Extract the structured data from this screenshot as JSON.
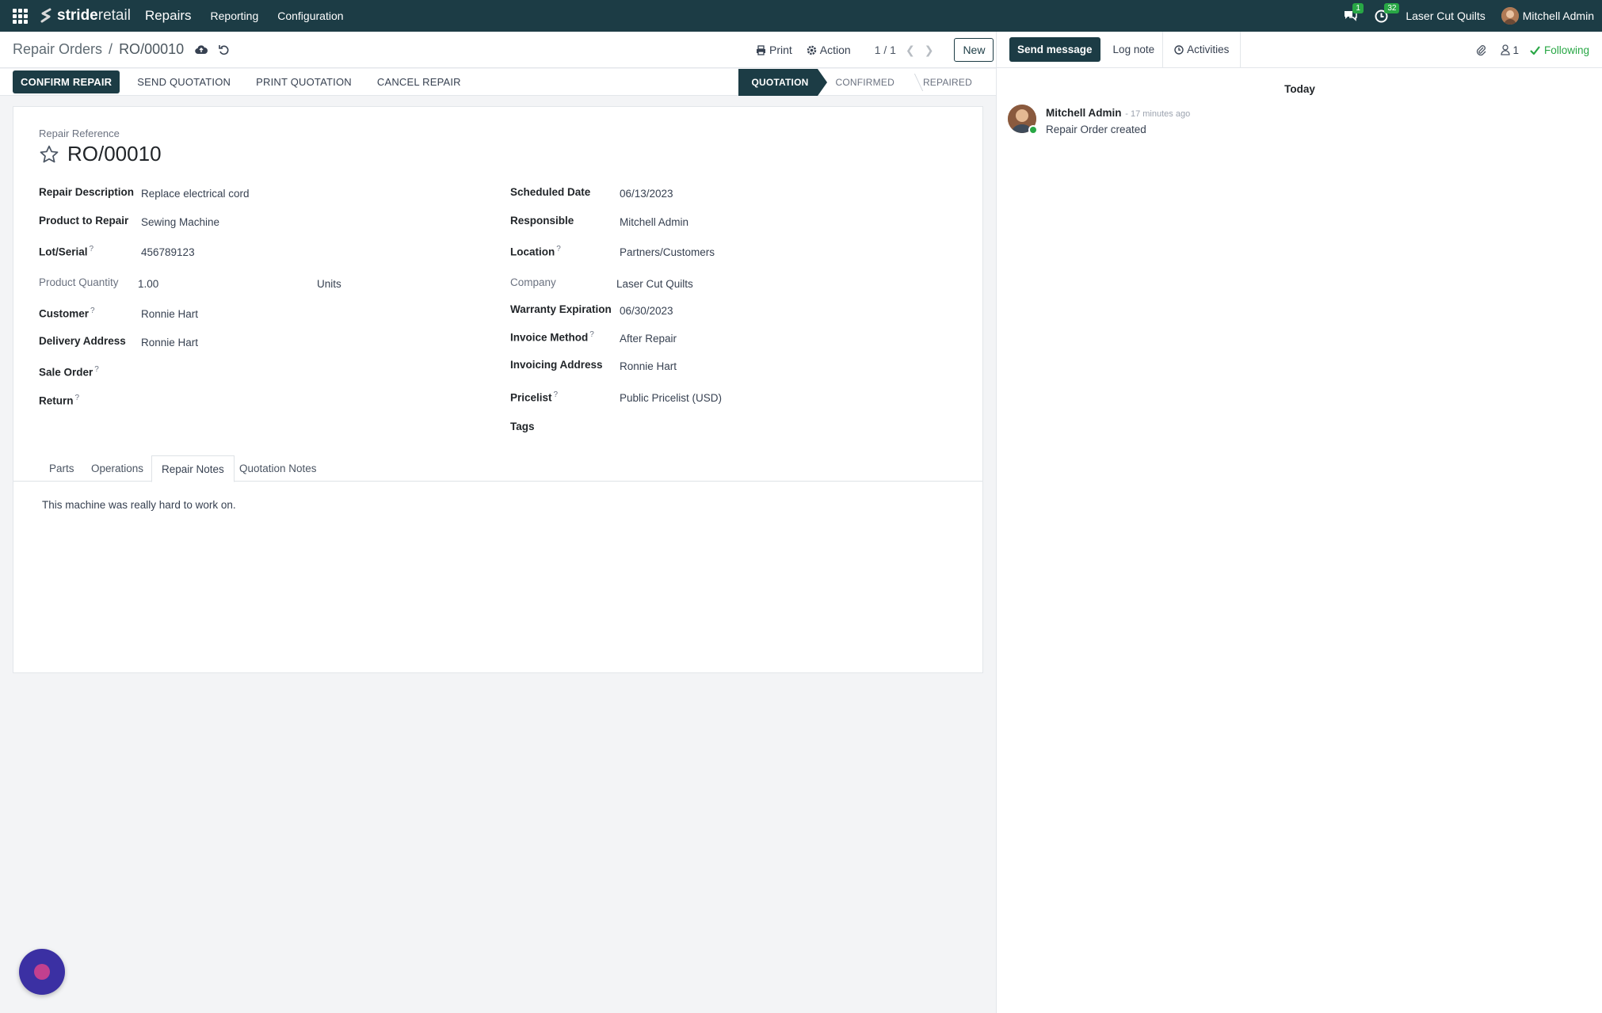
{
  "navbar": {
    "brand_bold": "stride",
    "brand_light": "retail",
    "app_name": "Repairs",
    "menu": [
      "Reporting",
      "Configuration"
    ],
    "messages_badge": "1",
    "activities_badge": "32",
    "company": "Laser Cut Quilts",
    "user": "Mitchell Admin"
  },
  "control": {
    "breadcrumb_parent": "Repair Orders",
    "breadcrumb_sep": "/",
    "breadcrumb_current": "RO/00010",
    "print_label": "Print",
    "action_label": "Action",
    "pager": "1 / 1",
    "new_label": "New"
  },
  "statusbar": {
    "confirm_label": "CONFIRM REPAIR",
    "send_label": "SEND QUOTATION",
    "print_label": "PRINT QUOTATION",
    "cancel_label": "CANCEL REPAIR",
    "stages": [
      "QUOTATION",
      "CONFIRMED",
      "REPAIRED"
    ],
    "active_stage": "QUOTATION"
  },
  "form": {
    "ref_label": "Repair Reference",
    "ref_value": "RO/00010",
    "left": {
      "repair_description": {
        "label": "Repair Description",
        "value": "Replace electrical cord"
      },
      "product": {
        "label": "Product to Repair",
        "value": "Sewing Machine"
      },
      "lot": {
        "label": "Lot/Serial",
        "value": "456789123"
      },
      "quantity": {
        "label": "Product Quantity",
        "value": "1.00",
        "uom": "Units"
      },
      "customer": {
        "label": "Customer",
        "value": "Ronnie Hart"
      },
      "delivery": {
        "label": "Delivery Address",
        "value": "Ronnie Hart"
      },
      "sale_order": {
        "label": "Sale Order",
        "value": ""
      },
      "return": {
        "label": "Return",
        "value": ""
      }
    },
    "right": {
      "scheduled": {
        "label": "Scheduled Date",
        "value": "06/13/2023"
      },
      "responsible": {
        "label": "Responsible",
        "value": "Mitchell Admin"
      },
      "location": {
        "label": "Location",
        "value": "Partners/Customers"
      },
      "company": {
        "label": "Company",
        "value": "Laser Cut Quilts"
      },
      "warranty": {
        "label": "Warranty Expiration",
        "value": "06/30/2023"
      },
      "invoice_method": {
        "label": "Invoice Method",
        "value": "After Repair"
      },
      "invoicing_address": {
        "label": "Invoicing Address",
        "value": "Ronnie Hart"
      },
      "pricelist": {
        "label": "Pricelist",
        "value": "Public Pricelist (USD)"
      },
      "tags": {
        "label": "Tags",
        "value": ""
      }
    },
    "help_mark": "?",
    "tabs": [
      "Parts",
      "Operations",
      "Repair Notes",
      "Quotation Notes"
    ],
    "active_tab": "Repair Notes",
    "notes_text": "This machine was really hard to work on."
  },
  "chatter": {
    "send_message": "Send message",
    "log_note": "Log note",
    "activities": "Activities",
    "followers_count": "1",
    "following": "Following",
    "today": "Today",
    "message": {
      "author": "Mitchell Admin",
      "time": "- 17 minutes ago",
      "text": "Repair Order created"
    }
  },
  "colors": {
    "brand": "#1c3c45",
    "success": "#28a745",
    "assistant": "#3b30a3"
  }
}
